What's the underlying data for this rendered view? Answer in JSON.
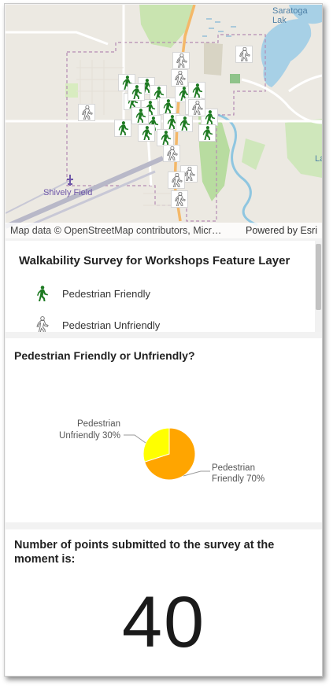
{
  "map": {
    "attribution": "Map data © OpenStreetMap contributors, Micr…",
    "powered_by": "Powered by Esri",
    "labels": {
      "airfield": "Shively Field",
      "lake": "Saratoga Lak",
      "edge": "La"
    },
    "icons": {
      "friendly": "pedestrian-friendly-icon",
      "unfriendly": "pedestrian-unfriendly-icon"
    }
  },
  "legend": {
    "title": "Walkability Survey for Workshops Feature Layer",
    "items": [
      {
        "label": "Pedestrian Friendly",
        "icon": "pedestrian-friendly-icon",
        "color": "#1e7a22"
      },
      {
        "label": "Pedestrian Unfriendly",
        "icon": "pedestrian-unfriendly-icon",
        "color": "#7a7a7a"
      }
    ]
  },
  "chart": {
    "title": "Pedestrian Friendly or Unfriendly?"
  },
  "chart_data": {
    "type": "pie",
    "title": "Pedestrian Friendly or Unfriendly?",
    "slices": [
      {
        "label_line1": "Pedestrian",
        "label_line2": "Friendly 70%",
        "value": 70,
        "color": "#ffa500"
      },
      {
        "label_line1": "Pedestrian",
        "label_line2": "Unfriendly 30%",
        "value": 30,
        "color": "#ffff00"
      }
    ]
  },
  "count": {
    "title": "Number of points submitted to the survey at the moment is:",
    "value": "40"
  }
}
